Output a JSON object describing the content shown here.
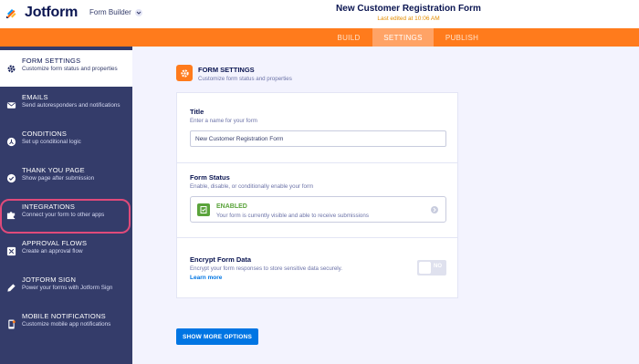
{
  "header": {
    "logo_text": "Jotform",
    "builder_label": "Form Builder",
    "form_title": "New Customer Registration Form",
    "last_edited": "Last edited at 10:06 AM"
  },
  "tabs": [
    {
      "label": "BUILD",
      "active": false
    },
    {
      "label": "SETTINGS",
      "active": true
    },
    {
      "label": "PUBLISH",
      "active": false
    }
  ],
  "sidebar": {
    "items": [
      {
        "title": "FORM SETTINGS",
        "subtitle": "Customize form status and properties",
        "icon": "gear-icon",
        "active": true
      },
      {
        "title": "EMAILS",
        "subtitle": "Send autoresponders and notifications",
        "icon": "envelope-icon",
        "active": false
      },
      {
        "title": "CONDITIONS",
        "subtitle": "Set up conditional logic",
        "icon": "conditions-icon",
        "active": false
      },
      {
        "title": "THANK YOU PAGE",
        "subtitle": "Show page after submission",
        "icon": "check-circle-icon",
        "active": false
      },
      {
        "title": "INTEGRATIONS",
        "subtitle": "Connect your form to other apps",
        "icon": "puzzle-icon",
        "active": false
      },
      {
        "title": "APPROVAL FLOWS",
        "subtitle": "Create an approval flow",
        "icon": "approval-flow-icon",
        "active": false
      },
      {
        "title": "JOTFORM SIGN",
        "subtitle": "Power your forms with Jotform Sign",
        "icon": "pen-icon",
        "active": false
      },
      {
        "title": "MOBILE NOTIFICATIONS",
        "subtitle": "Customize mobile app notifications",
        "icon": "mobile-icon",
        "active": false
      }
    ]
  },
  "main": {
    "section_title": "FORM SETTINGS",
    "section_subtitle": "Customize form status and properties",
    "title_label": "Title",
    "title_desc": "Enter a name for your form",
    "title_value": "New Customer Registration Form",
    "status_label": "Form Status",
    "status_desc": "Enable, disable, or conditionally enable your form",
    "status_value": "ENABLED",
    "status_value_desc": "Your form is currently visible and able to receive submissions",
    "encrypt_label": "Encrypt Form Data",
    "encrypt_desc": "Encrypt your form responses to store sensitive data securely.",
    "learn_more": "Learn more",
    "encrypt_toggle": "NO",
    "more_button": "SHOW MORE OPTIONS"
  },
  "colors": {
    "orange": "#ff7b1c",
    "sidebar": "#343c6a",
    "highlight": "#e04a7a",
    "enabled_green": "#5aa33b",
    "blue": "#0075e3"
  }
}
